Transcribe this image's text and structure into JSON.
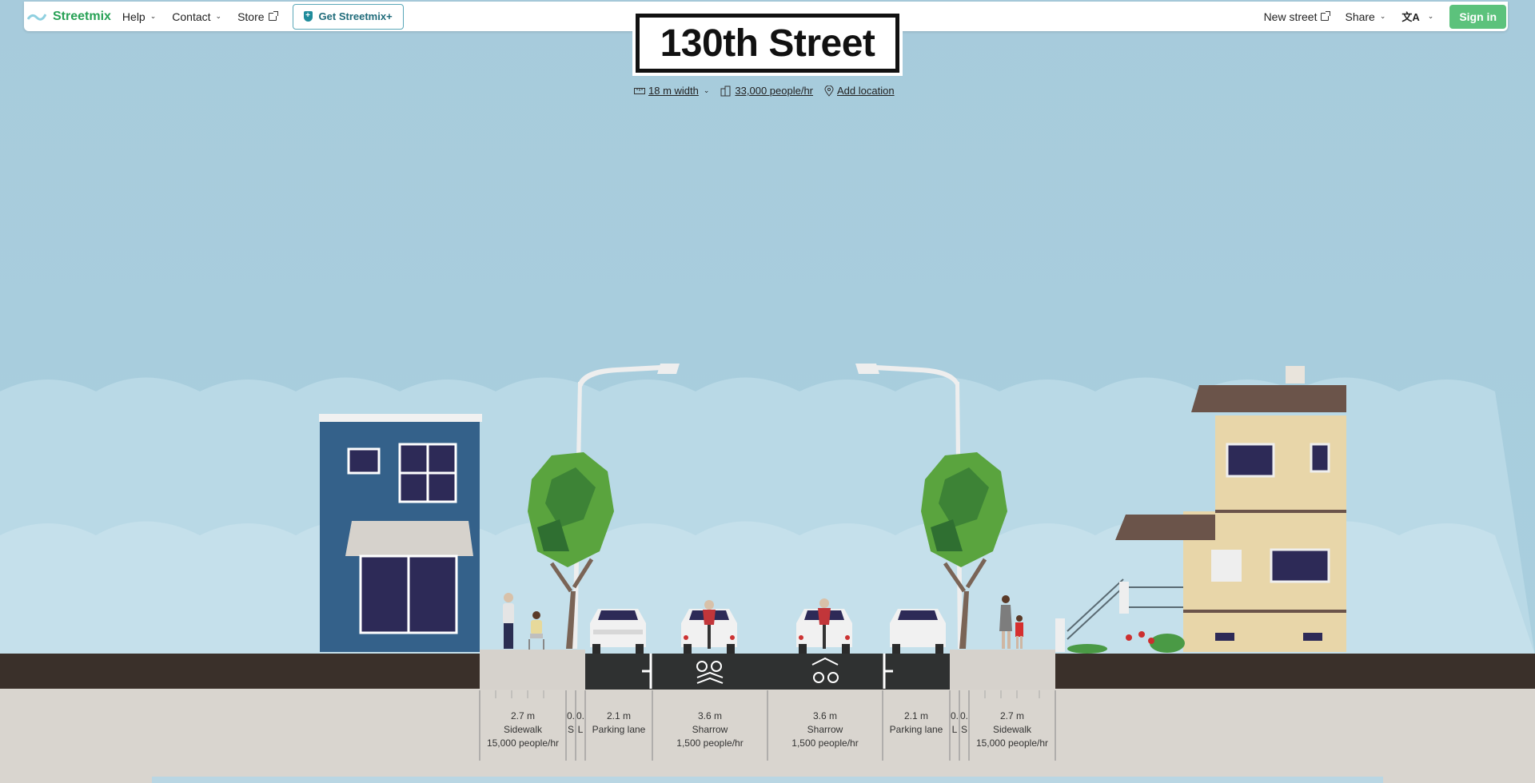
{
  "nav": {
    "logo": "Streetmix",
    "help": "Help",
    "contact": "Contact",
    "store": "Store",
    "get_plus": "Get Streetmix+",
    "new_street": "New street",
    "share": "Share",
    "lang_icon": "文A",
    "sign_in": "Sign in"
  },
  "street": {
    "name": "130th Street",
    "width": "18 m width",
    "capacity": "33,000 people/hr",
    "location": "Add location"
  },
  "segments": [
    {
      "width": "2.7 m",
      "name": "Sidewalk",
      "capacity": "15,000 people/hr"
    },
    {
      "width": "0.",
      "name": "S",
      "capacity": ""
    },
    {
      "width": "0.",
      "name": "L",
      "capacity": ""
    },
    {
      "width": "2.1 m",
      "name": "Parking lane",
      "capacity": ""
    },
    {
      "width": "3.6 m",
      "name": "Sharrow",
      "capacity": "1,500 people/hr"
    },
    {
      "width": "3.6 m",
      "name": "Sharrow",
      "capacity": "1,500 people/hr"
    },
    {
      "width": "2.1 m",
      "name": "Parking lane",
      "capacity": ""
    },
    {
      "width": "0.",
      "name": "L",
      "capacity": ""
    },
    {
      "width": "0.",
      "name": "S",
      "capacity": ""
    },
    {
      "width": "2.7 m",
      "name": "Sidewalk",
      "capacity": "15,000 people/hr"
    }
  ],
  "colors": {
    "sky": "#a9cddd",
    "ground": "#3a302a",
    "road": "#2f3131",
    "sidewalk": "#d9d5cf",
    "brand": "#27a155",
    "signin": "#5cc27c"
  }
}
